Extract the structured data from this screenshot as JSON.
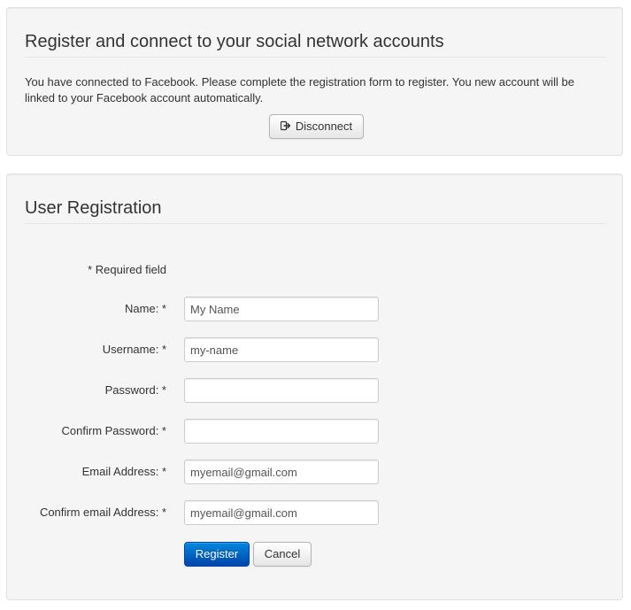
{
  "connect_panel": {
    "title": "Register and connect to your social network accounts",
    "message": "You have connected to Facebook. Please complete the registration form to register. You new account will be linked to your Facebook account automatically.",
    "disconnect_label": "Disconnect",
    "disconnect_icon": "sign-out-icon"
  },
  "registration": {
    "title": "User Registration",
    "required_note": "* Required field",
    "fields": [
      {
        "label": "Name: *",
        "value": "My Name",
        "type": "text"
      },
      {
        "label": "Username: *",
        "value": "my-name",
        "type": "text"
      },
      {
        "label": "Password: *",
        "value": "",
        "type": "password"
      },
      {
        "label": "Confirm Password: *",
        "value": "",
        "type": "password"
      },
      {
        "label": "Email Address: *",
        "value": "myemail@gmail.com",
        "type": "text"
      },
      {
        "label": "Confirm email Address: *",
        "value": "myemail@gmail.com",
        "type": "text"
      }
    ],
    "register_label": "Register",
    "cancel_label": "Cancel"
  },
  "colors": {
    "panel_bg": "#f5f5f5",
    "primary_button": "#0055cc"
  }
}
